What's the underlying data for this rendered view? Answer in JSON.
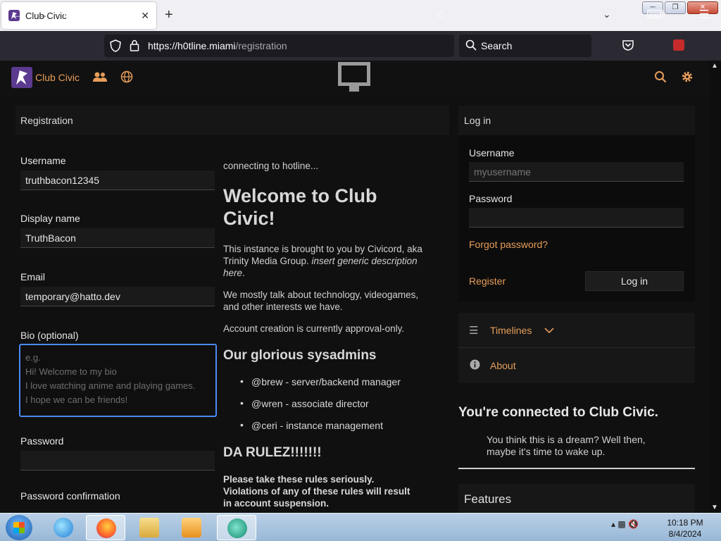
{
  "browser": {
    "tab_title": "Club Civic",
    "tab_close": "✕",
    "new_tab": "+",
    "url_host": "https://h0tline.miami",
    "url_path": "/registration",
    "search_placeholder": "Search"
  },
  "header": {
    "brand": "Club Civic"
  },
  "registration": {
    "title": "Registration",
    "username_label": "Username",
    "username_value": "truthbacon12345",
    "display_name_label": "Display name",
    "display_name_value": "TruthBacon",
    "email_label": "Email",
    "email_value": "temporary@hatto.dev",
    "bio_label": "Bio (optional)",
    "bio_placeholder": "e.g.\nHi! Welcome to my bio\nI love watching anime and playing games.\nI hope we can be friends!",
    "password_label": "Password",
    "password_confirm_label": "Password confirmation"
  },
  "welcome": {
    "status": "connecting to hotline...",
    "heading_line1": "Welcome to Club",
    "heading_line2": "Civic!",
    "intro_line1": "This instance is brought to you by Civicord, aka",
    "intro_line2_plain": "Trinity Media Group. ",
    "intro_line2_italic": "insert generic description",
    "intro_line3_italic": "here",
    "intro_line3_plain": ".",
    "talk_line1": "We mostly talk about technology, videogames,",
    "talk_line2": "and other interests we have.",
    "approval": "Account creation is currently approval-only.",
    "sysadmins_heading": "Our glorious sysadmins",
    "sysadmins": [
      "@brew - server/backend manager",
      "@wren - associate director",
      "@ceri - instance management"
    ],
    "rules_heading": "DA RULEZ!!!!!!!",
    "rules_line1": "Please take these rules seriously.",
    "rules_line2": "Violations of any of these rules will result",
    "rules_line3": "in account suspension."
  },
  "login": {
    "title": "Log in",
    "username_label": "Username",
    "username_placeholder": "myusername",
    "password_label": "Password",
    "forgot": "Forgot password?",
    "register": "Register",
    "login_button": "Log in"
  },
  "sidebar": {
    "timelines": "Timelines",
    "about": "About",
    "connected_title": "You're connected to Club Civic.",
    "connected_line1": "You think this is a dream? Well then,",
    "connected_line2": "maybe it's time to wake up.",
    "features": "Features"
  },
  "taskbar": {
    "time": "10:18 PM",
    "date": "8/4/2024"
  },
  "colors": {
    "accent": "#e79e5a",
    "focus": "#4c8af5",
    "logo": "#5b3a8f"
  }
}
